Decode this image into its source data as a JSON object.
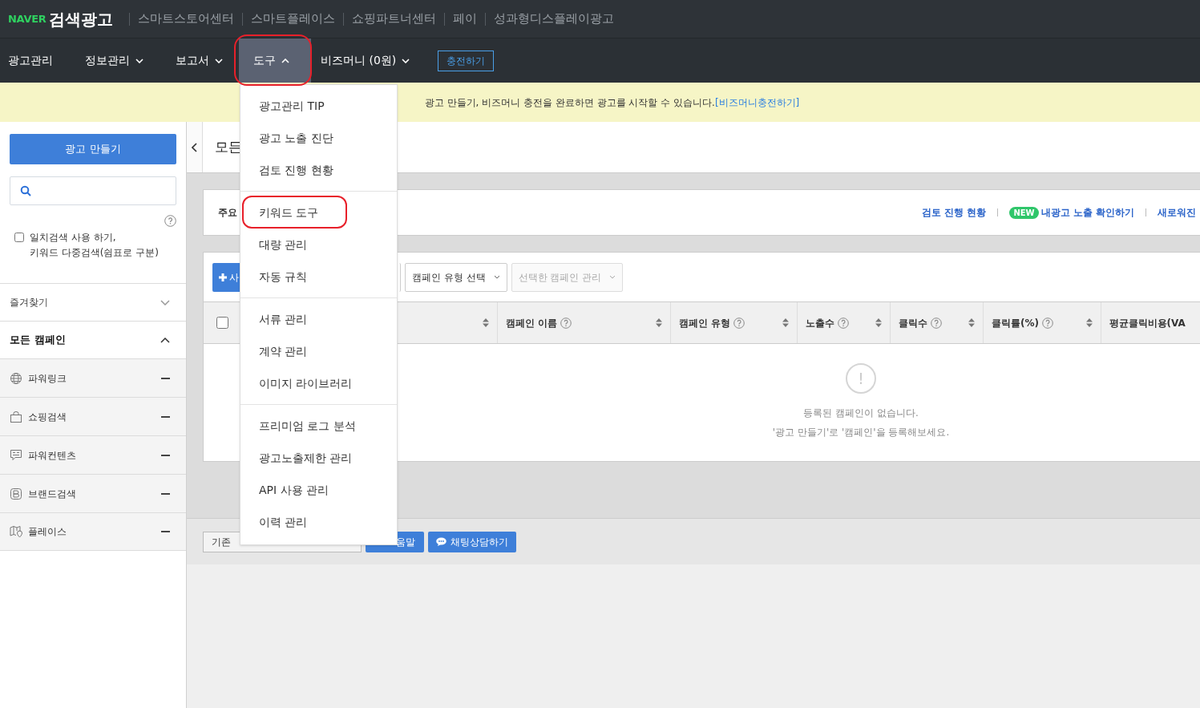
{
  "header": {
    "brand_logo": "NAVER",
    "brand_title": "검색광고",
    "links": [
      "스마트스토어센터",
      "스마트플레이스",
      "쇼핑파트너센터",
      "페이",
      "성과형디스플레이광고"
    ]
  },
  "nav": {
    "items": [
      {
        "label": "광고관리",
        "has_menu": false,
        "expanded": false
      },
      {
        "label": "정보관리",
        "has_menu": true,
        "expanded": false
      },
      {
        "label": "보고서",
        "has_menu": true,
        "expanded": false
      },
      {
        "label": "도구",
        "has_menu": true,
        "expanded": true
      },
      {
        "label": "비즈머니 (0원)",
        "has_menu": true,
        "expanded": false
      }
    ],
    "charge_button": "충전하기"
  },
  "banner": {
    "message": "광고 만들기, 비즈머니 충전을 완료하면 광고를 시작할 수 있습니다.",
    "link": "[비즈머니충전하기]"
  },
  "sidebar": {
    "create_button": "광고 만들기",
    "exact_match": {
      "lines": [
        "일치검색 사용 하기,",
        "키워드 다중검색(쉼표로 구분)"
      ],
      "checked": false
    },
    "favorites": {
      "label": "즐겨찾기",
      "expanded": false
    },
    "all_campaigns": {
      "label": "모든 캠페인",
      "expanded": true
    },
    "campaign_types": [
      {
        "label": "파워링크",
        "kind": "globe"
      },
      {
        "label": "쇼핑검색",
        "kind": "bag"
      },
      {
        "label": "파워컨텐츠",
        "kind": "chat"
      },
      {
        "label": "브랜드검색",
        "kind": "brand"
      },
      {
        "label": "플레이스",
        "kind": "map"
      }
    ]
  },
  "content": {
    "title": "모든",
    "notice": {
      "title": "주요",
      "links": [
        {
          "label": "검토 진행 현황"
        },
        {
          "label": "내광고 노출 확인하기",
          "badge": "NEW"
        },
        {
          "label": "새로워진"
        }
      ]
    },
    "toolbar": {
      "add_button": "사",
      "type_select": "캠페인 유형 선택",
      "manage_select": {
        "label": "선택한 캠페인 관리",
        "disabled": true
      }
    },
    "table": {
      "select_all": {
        "checked": false
      },
      "columns": [
        {
          "help": false,
          "sortable": true
        },
        {
          "label": "캠페인 이름",
          "help": true,
          "sortable": true
        },
        {
          "label": "캠페인 유형",
          "help": true,
          "sortable": true
        },
        {
          "label": "노출수",
          "help": true,
          "sortable": true
        },
        {
          "label": "클릭수",
          "help": true,
          "sortable": true
        },
        {
          "label": "클릭률(%)",
          "help": true,
          "sortable": true
        },
        {
          "label": "평균클릭비용(VA",
          "help": false
        }
      ],
      "empty": {
        "icon": "!",
        "lines": [
          "등록된 캠페인이 없습니다.",
          "'광고 만들기'로 '캠페인'을 등록해보세요."
        ]
      }
    },
    "footer": [
      {
        "label": "기존",
        "kind": "outline"
      },
      {
        "label": "움말",
        "kind": "help"
      },
      {
        "label": "채팅상담하기",
        "kind": "chat"
      }
    ]
  },
  "dropdown": {
    "groups": [
      [
        "광고관리 TIP",
        "광고 노출 진단",
        "검토 진행 현황"
      ],
      [
        "키워드 도구",
        "대량 관리",
        "자동 규칙"
      ],
      [
        "서류 관리",
        "계약 관리",
        "이미지 라이브러리"
      ],
      [
        "프리미엄 로그 분석",
        "광고노출제한 관리",
        "API 사용 관리",
        "이력 관리"
      ]
    ]
  }
}
